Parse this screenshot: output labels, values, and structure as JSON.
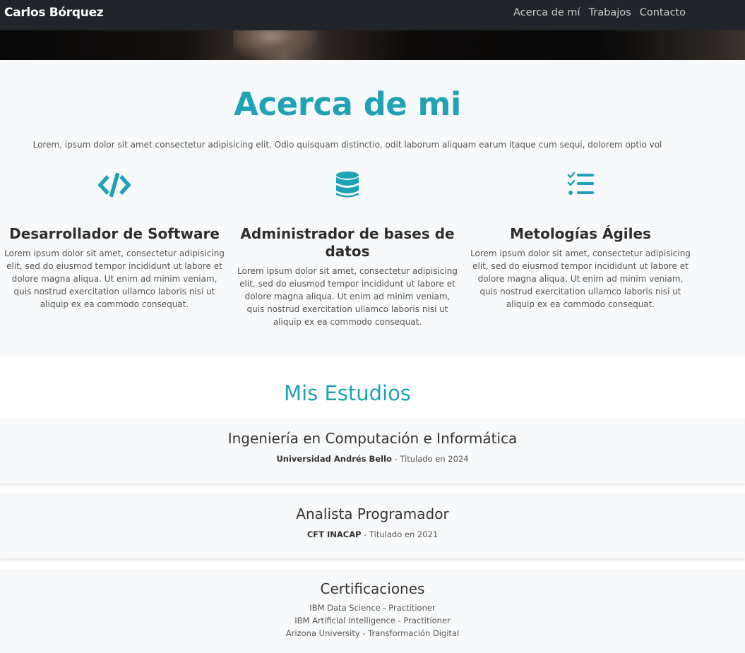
{
  "navbar": {
    "brand": "Carlos Bórquez",
    "links": [
      "Acerca de mí",
      "Trabajos",
      "Contacto"
    ]
  },
  "about": {
    "title": "Acerca de mi",
    "intro": "Lorem, ipsum dolor sit amet consectetur adipisicing elit. Odio quisquam distinctio, odit laborum aliquam earum itaque cum sequi, dolorem optio vol",
    "columns": [
      {
        "icon": "code-icon",
        "title": "Desarrollador de Software",
        "text": "Lorem ipsum dolor sit amet, consectetur adipisicing elit, sed do eiusmod tempor incididunt ut labore et dolore magna aliqua. Ut enim ad minim veniam, quis nostrud exercitation ullamco laboris nisi ut aliquip ex ea commodo consequat."
      },
      {
        "icon": "database-icon",
        "title": "Administrador de bases de datos",
        "text": "Lorem ipsum dolor sit amet, consectetur adipisicing elit, sed do eiusmod tempor incididunt ut labore et dolore magna aliqua. Ut enim ad minim veniam, quis nostrud exercitation ullamco laboris nisi ut aliquip ex ea commodo consequat."
      },
      {
        "icon": "list-check-icon",
        "title": "Metologías Ágiles",
        "text": "Lorem ipsum dolor sit amet, consectetur adipisicing elit, sed do eiusmod tempor incididunt ut labore et dolore magna aliqua. Ut enim ad minim veniam, quis nostrud exercitation ullamco laboris nisi ut aliquip ex ea commodo consequat."
      }
    ]
  },
  "studies": {
    "title": "Mis Estudios",
    "items": [
      {
        "name": "Ingeniería en Computación e Informática",
        "institution": "Universidad Andrés Bello",
        "status": " - Titulado en 2024"
      },
      {
        "name": "Analista Programador",
        "institution": "CFT INACAP",
        "status": " - Titulado en 2021"
      }
    ],
    "certifications": {
      "title": "Certificaciones",
      "lines": [
        "IBM Data Science - Practitioner",
        "IBM Artificial Intelligence - Practitioner",
        "Arizona University - Transformación Digital"
      ]
    }
  },
  "colors": {
    "accent": "#1fa2b5",
    "navbar": "#212529",
    "section_bg": "#f8f9fa"
  }
}
